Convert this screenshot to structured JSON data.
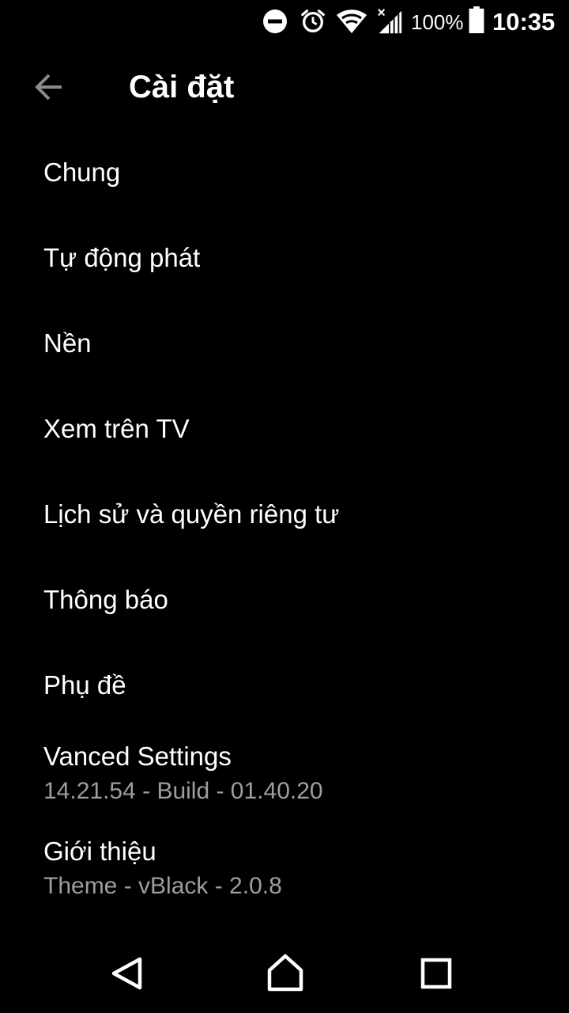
{
  "status_bar": {
    "icons": [
      "do-not-disturb-icon",
      "alarm-icon",
      "wifi-icon",
      "signal-icon",
      "battery-icon"
    ],
    "battery_text": "100%",
    "time": "10:35"
  },
  "toolbar": {
    "back_icon": "arrow-back-icon",
    "title": "Cài đặt"
  },
  "settings": {
    "items": [
      {
        "label": "Chung"
      },
      {
        "label": "Tự động phát"
      },
      {
        "label": "Nền"
      },
      {
        "label": "Xem trên TV"
      },
      {
        "label": "Lịch sử và quyền riêng tư"
      },
      {
        "label": "Thông báo"
      },
      {
        "label": "Phụ đề"
      },
      {
        "label": "Vanced Settings",
        "sublabel": "14.21.54 - Build - 01.40.20"
      },
      {
        "label": "Giới thiệu",
        "sublabel": "Theme - vBlack - 2.0.8"
      }
    ]
  },
  "nav_bar": {
    "icons": [
      "nav-back-icon",
      "nav-home-icon",
      "nav-recents-icon"
    ]
  },
  "colors": {
    "background": "#000000",
    "text_primary": "#ffffff",
    "text_secondary": "#9e9e9e",
    "back_arrow": "#8a8a8a"
  }
}
